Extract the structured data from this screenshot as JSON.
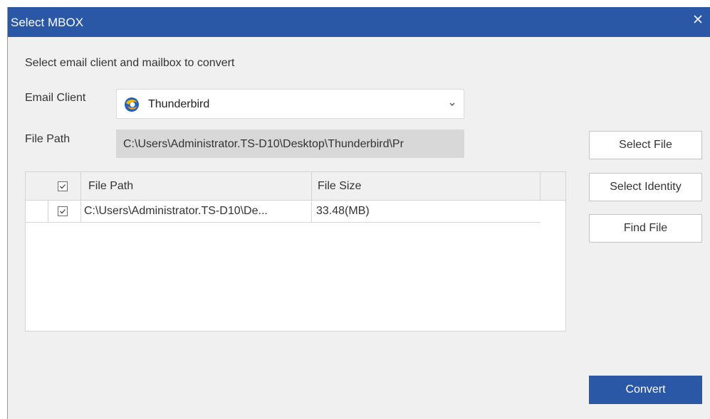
{
  "window": {
    "title": "Select MBOX"
  },
  "form": {
    "instruction": "Select email client and mailbox to convert",
    "email_client_label": "Email Client",
    "email_client_value": "Thunderbird",
    "file_path_label": "File Path",
    "file_path_value": "C:\\Users\\Administrator.TS-D10\\Desktop\\Thunderbird\\Pr"
  },
  "buttons": {
    "select_file": "Select File",
    "select_identity": "Select Identity",
    "find_file": "Find File",
    "convert": "Convert"
  },
  "grid": {
    "columns": [
      "File Path",
      "File Size"
    ],
    "header_checked": true,
    "rows": [
      {
        "checked": true,
        "file_path": "C:\\Users\\Administrator.TS-D10\\De...",
        "file_size": "33.48(MB)"
      }
    ]
  },
  "icons": {
    "close": "close-icon",
    "client": "thunderbird-icon",
    "dropdown": "chevron-down-icon",
    "check": "checkmark-icon"
  },
  "colors": {
    "accent": "#2a57a6",
    "window_bg": "#f0f0f0",
    "field_disabled_bg": "#d8d8d8"
  }
}
